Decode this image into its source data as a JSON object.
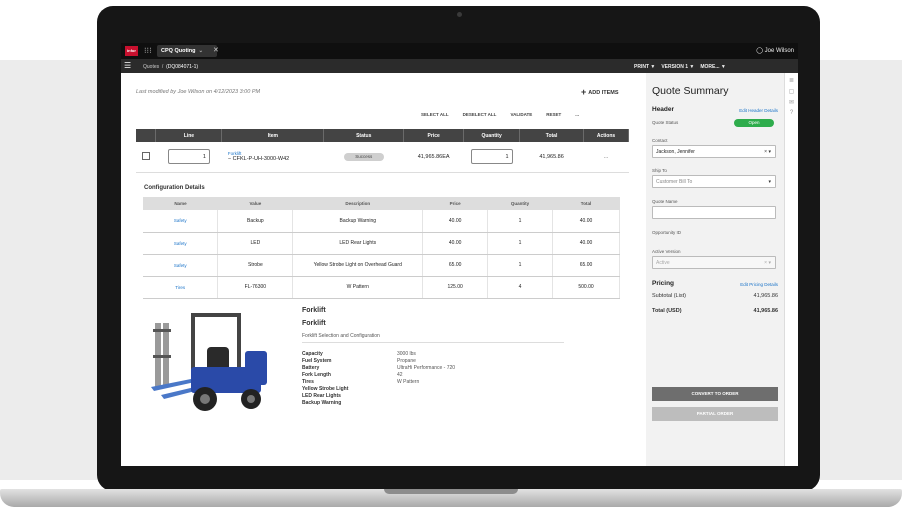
{
  "topbar": {
    "app_tab": "CPQ Quoting",
    "user": "Joe Wilson"
  },
  "nav": {
    "crumb_root": "Quotes",
    "crumb_current": "(DQ084071-1)",
    "menu": [
      "PRINT ▼",
      "VERSION 1 ▼",
      "MORE... ▼"
    ]
  },
  "page": {
    "last_modified": "Last modified by Joe Wilson on 4/12/2023 3:00 PM",
    "add_items": "ADD ITEMS"
  },
  "actions": [
    "SELECT ALL",
    "DESELECT ALL",
    "VALIDATE",
    "RESET",
    "..."
  ],
  "line_table": {
    "headers": [
      "Line",
      "Item",
      "Status",
      "Price",
      "Quantity",
      "Total",
      "Actions"
    ],
    "row": {
      "line": "1",
      "item_link": "Forklift",
      "item_code": "CFKL-P-UH-3000-W42",
      "status": "Success",
      "price": "41,965.86EA",
      "quantity": "1",
      "total": "41,965.86",
      "actions": "..."
    }
  },
  "config": {
    "title": "Configuration Details",
    "headers": [
      "Name",
      "Value",
      "Description",
      "Price",
      "Quantity",
      "Total"
    ],
    "rows": [
      [
        "Safety",
        "Backup",
        "Backup Warning",
        "40.00",
        "1",
        "40.00"
      ],
      [
        "Safety",
        "LED",
        "LED Rear Lights",
        "40.00",
        "1",
        "40.00"
      ],
      [
        "Safety",
        "Strobe",
        "Yellow Strobe Light on Overhead Guard",
        "65.00",
        "1",
        "65.00"
      ],
      [
        "Tires",
        "FL-76300",
        "W Pattern",
        "125.00",
        "4",
        "500.00"
      ]
    ]
  },
  "product": {
    "name1": "Forklift",
    "name2": "Forklift",
    "subtitle": "Forklift Selection and Configuration",
    "specs": [
      {
        "k": "Capacity",
        "v": "3000 lbs"
      },
      {
        "k": "Fuel System",
        "v": "Propane"
      },
      {
        "k": "Battery",
        "v": "UltraHi Performance - 720"
      },
      {
        "k": "Fork Length",
        "v": "42"
      },
      {
        "k": "Tires",
        "v": "W Pattern"
      },
      {
        "k": "Yellow Strobe Light",
        "v": ""
      },
      {
        "k": "LED Rear Lights",
        "v": ""
      },
      {
        "k": "Backup Warning",
        "v": ""
      }
    ]
  },
  "summary": {
    "title": "Quote Summary",
    "header_label": "Header",
    "edit_header": "Edit Header Details",
    "quote_status_label": "Quote Status",
    "quote_status": "Open",
    "contact_label": "Contact",
    "contact": "Jackson, Jennifer",
    "ship_to_label": "Ship To",
    "ship_to": "Customer Bill To",
    "quote_name_label": "Quote Name",
    "quote_name": "",
    "opportunity_label": "Opportunity ID",
    "active_version_label": "Active Version",
    "active_version": "Active",
    "pricing_label": "Pricing",
    "edit_pricing": "Edit Pricing Details",
    "subtotal_label": "Subtotal (List)",
    "subtotal": "41,965.86",
    "total_label": "Total (USD)",
    "total": "41,965.86",
    "convert_button": "CONVERT TO ORDER",
    "partial_button": "PARTIAL ORDER"
  },
  "colors": {
    "accent": "#1a73c8",
    "status_open": "#2eac4c",
    "logo": "#c8102e"
  }
}
